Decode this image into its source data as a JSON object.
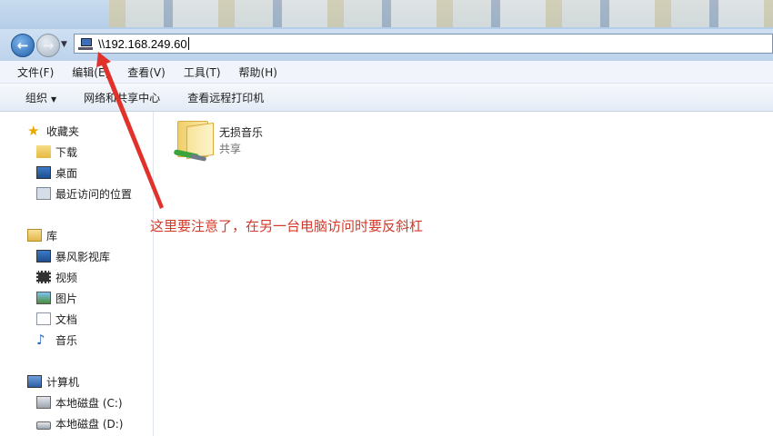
{
  "address": {
    "value": "\\\\192.168.249.60"
  },
  "menu": [
    "文件(F)",
    "编辑(E)",
    "查看(V)",
    "工具(T)",
    "帮助(H)"
  ],
  "toolbar": {
    "organize": "组织",
    "network_center": "网络和共享中心",
    "remote_printers": "查看远程打印机"
  },
  "nav": {
    "favorites": "收藏夹",
    "downloads": "下载",
    "desktop": "桌面",
    "recent": "最近访问的位置",
    "libraries": "库",
    "baofeng": "暴风影视库",
    "videos": "视频",
    "pictures": "图片",
    "documents": "文档",
    "music": "音乐",
    "computer": "计算机",
    "disk_c": "本地磁盘 (C:)",
    "disk_d": "本地磁盘 (D:)"
  },
  "content": {
    "folder_name": "无损音乐",
    "folder_sub": "共享"
  },
  "annotation": {
    "text": "这里要注意了，在另一台电脑访问时要反斜杠",
    "color": "#d23a2a"
  },
  "icons": [
    "back-arrow-icon",
    "forward-arrow-icon",
    "computer-icon",
    "star-icon",
    "folder-icon",
    "desktop-icon",
    "recent-places-icon",
    "library-icon",
    "video-icon",
    "picture-icon",
    "document-icon",
    "music-note-icon",
    "drive-icon",
    "shared-folder-icon"
  ]
}
